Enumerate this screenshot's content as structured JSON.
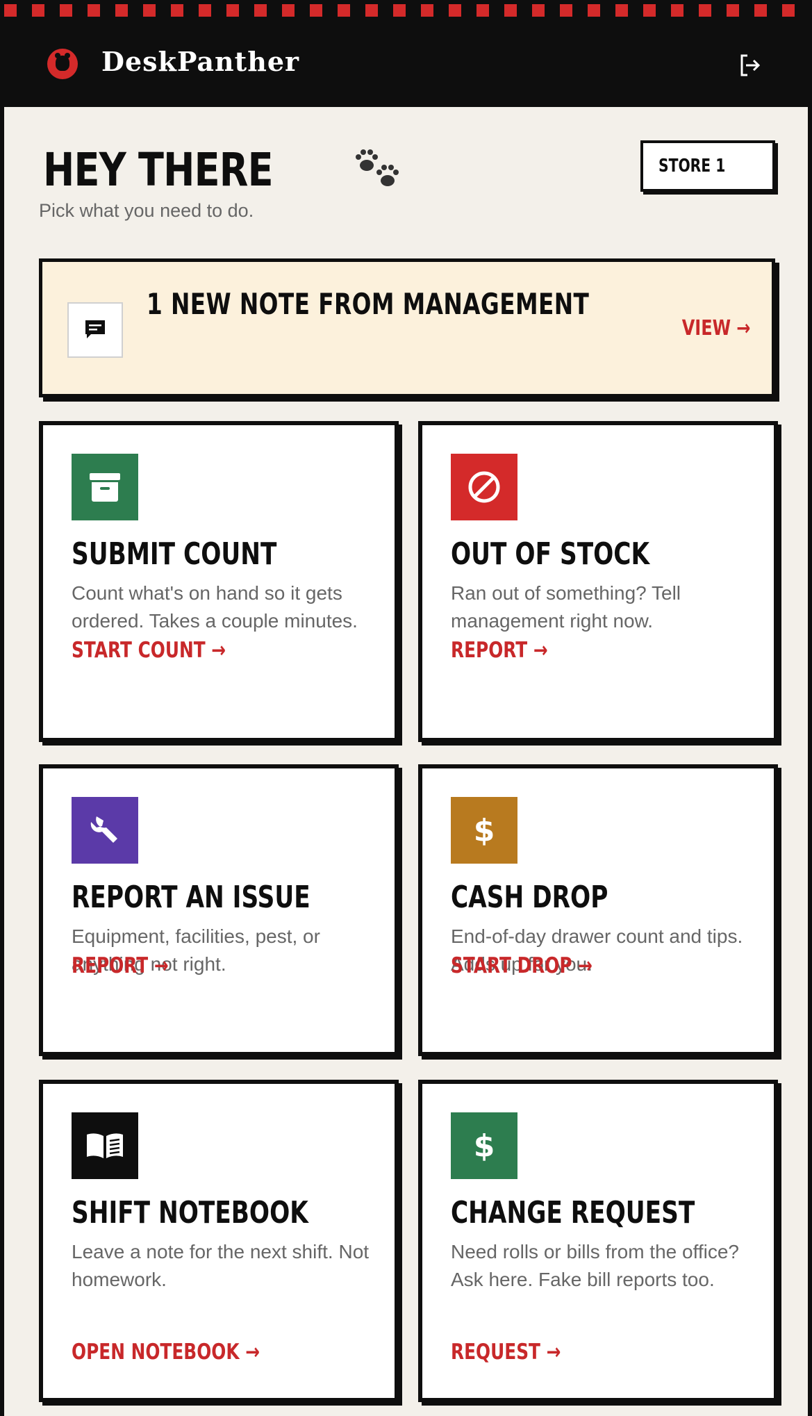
{
  "app": {
    "brand": "DeskPanther"
  },
  "header": {
    "logout_icon": "logout-icon",
    "accent": "#d42a2a"
  },
  "greeting": {
    "title": "HEY THERE",
    "subtitle": "Pick what you need to do."
  },
  "store": {
    "label": "STORE 1"
  },
  "notice": {
    "title": "1 NEW NOTE FROM MANAGEMENT",
    "action": "VIEW →",
    "icon": "message-icon"
  },
  "cards": [
    {
      "title": "SUBMIT COUNT",
      "description": "Count what's on hand so it gets ordered. Takes a couple minutes.",
      "action": "START COUNT →",
      "icon": "archive-box-icon",
      "color": "#2d7d4f"
    },
    {
      "title": "OUT OF STOCK",
      "description": "Ran out of something? Tell management right now.",
      "action": "REPORT →",
      "icon": "prohibited-icon",
      "color": "#d42a2a"
    },
    {
      "title": "REPORT AN ISSUE",
      "description": "Equipment, facilities, pest, or anything not right.",
      "action": "REPORT →",
      "icon": "wrench-icon",
      "color": "#5b3aa8"
    },
    {
      "title": "CASH DROP",
      "description": "End-of-day drawer count and tips. Adds up for you.",
      "action": "START DROP →",
      "icon": "dollar-icon",
      "color": "#b87a1f"
    },
    {
      "title": "SHIFT NOTEBOOK",
      "description": "Leave a note for the next shift. Not homework.",
      "action": "OPEN NOTEBOOK →",
      "icon": "book-icon",
      "color": "#0e0e0e"
    },
    {
      "title": "CHANGE REQUEST",
      "description": "Need rolls or bills from the office? Ask here. Fake bill reports too.",
      "action": "REQUEST →",
      "icon": "dollar-icon",
      "color": "#2d7d4f"
    }
  ]
}
